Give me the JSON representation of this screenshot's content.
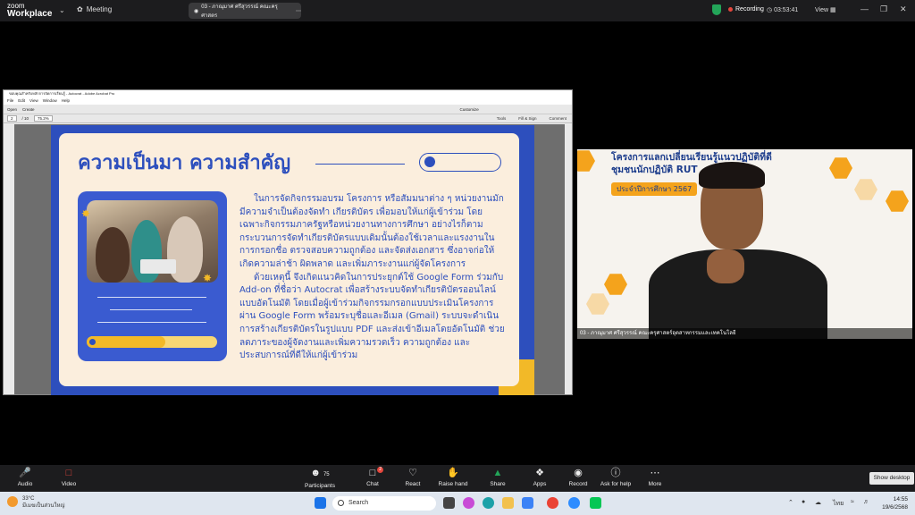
{
  "zoom": {
    "brand_line1": "zoom",
    "brand_line2": "Workplace",
    "meeting_label": "Meeting",
    "share_label": "03 - ภาณุมาศ ศรีสุวรรณ์ คณะครุศาสตร",
    "recording_label": "Recording",
    "timer": "03:53:41",
    "view_label": "View"
  },
  "acrobat": {
    "title": "ขอบคุณสำหรับหลักการจัดการเรียนรู้ - Autocrat - Adobe Acrobat Pro",
    "menu": [
      "File",
      "Edit",
      "View",
      "Window",
      "Help"
    ],
    "open_label": "Open",
    "create_label": "Create",
    "customize_label": "Customize",
    "page_current": "2",
    "page_total": "/ 10",
    "zoom_value": "75.2%",
    "tools_label": "Tools",
    "fill_sign_label": "Fill & Sign",
    "comment_label": "Comment"
  },
  "slide": {
    "title": "ความเป็นมา ความสำคัญ",
    "paragraph1": "ในการจัดกิจกรรมอบรม โครงการ หรือสัมมนาต่าง ๆ หน่วยงานมักมีความจำเป็นต้องจัดทำ เกียรติบัตร เพื่อมอบให้แก่ผู้เข้าร่วม โดยเฉพาะกิจกรรมภาครัฐหรือหน่วยงานทางการศึกษา อย่างไรก็ตาม กระบวนการจัดทำเกียรติบัตรแบบเดิมนั้นต้องใช้เวลาและแรงงานในการกรอกชื่อ ตรวจสอบความถูกต้อง และจัดส่งเอกสาร ซึ่งอาจก่อให้เกิดความล่าช้า ผิดพลาด และเพิ่มภาระงานแก่ผู้จัดโครงการ",
    "paragraph2": "ด้วยเหตุนี้ จึงเกิดแนวคิดในการประยุกต์ใช้ Google Form ร่วมกับ Add-on ที่ชื่อว่า Autocrat เพื่อสร้างระบบจัดทำเกียรติบัตรออนไลน์แบบอัตโนมัติ โดยเมื่อผู้เข้าร่วมกิจกรรมกรอกแบบประเมินโครงการผ่าน Google Form พร้อมระบุชื่อและอีเมล (Gmail) ระบบจะดำเนินการสร้างเกียรติบัตรในรูปแบบ PDF และส่งเข้าอีเมลโดยอัตโนมัติ ช่วยลดภาระของผู้จัดงานและเพิ่มความรวดเร็ว ความถูกต้อง และประสบการณ์ที่ดีให้แก่ผู้เข้าร่วม",
    "progress_fraction": 0.6,
    "colors": {
      "primary": "#2d4fbd",
      "accent": "#f2b928",
      "card": "#fbeedd"
    }
  },
  "video": {
    "banner_line1": "โครงการแลกเปลี่ยนเรียนรู้แนวปฏิบัติที่ดี",
    "banner_line2": "ชุมชนนักปฏิบัติ RUT",
    "banner_sub": "ประจำปีการศึกษา 2567",
    "participant_name": "03 - ภาณุมาศ ศรีสุวรรณ์ คณะครุศาสตร์อุตสาหกรรมและเทคโนโลยี"
  },
  "toolbar": {
    "audio": "Audio",
    "video": "Video",
    "participants": "Participants",
    "participants_count": "75",
    "chat": "Chat",
    "chat_badge": "2",
    "react": "React",
    "raise_hand": "Raise hand",
    "share": "Share",
    "apps": "Apps",
    "record": "Record",
    "help": "Ask for help",
    "more": "More",
    "show_desktop": "Show desktop"
  },
  "taskbar": {
    "temperature": "33°C",
    "weather_desc": "มีเมฆเป็นส่วนใหญ่",
    "search_label": "Search",
    "lang": "ไทย",
    "time": "14:55",
    "date": "19/6/2568"
  },
  "icons": [
    "shield-icon",
    "search-icon",
    "windows-start-icon",
    "chevron-down-icon",
    "mic-off-icon",
    "camera-off-icon",
    "participants-icon",
    "chat-icon",
    "heart-icon",
    "hand-icon",
    "share-icon",
    "apps-icon",
    "record-icon",
    "help-icon",
    "more-icon"
  ]
}
